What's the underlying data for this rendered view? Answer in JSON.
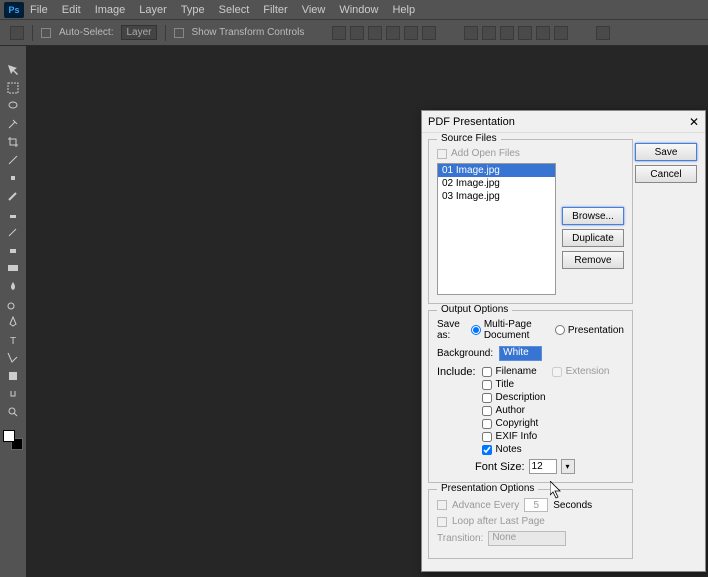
{
  "menu": [
    "File",
    "Edit",
    "Image",
    "Layer",
    "Type",
    "Select",
    "Filter",
    "View",
    "Window",
    "Help"
  ],
  "options": {
    "auto_select": "Auto-Select:",
    "layer": "Layer",
    "show_transform": "Show Transform Controls"
  },
  "dialog": {
    "title": "PDF Presentation",
    "source": {
      "legend": "Source Files",
      "add_open": "Add Open Files",
      "files": [
        "01 Image.jpg",
        "02 Image.jpg",
        "03 Image.jpg"
      ],
      "browse": "Browse...",
      "duplicate": "Duplicate",
      "remove": "Remove"
    },
    "save": "Save",
    "cancel": "Cancel",
    "output": {
      "legend": "Output Options",
      "save_as": "Save as:",
      "multi": "Multi-Page Document",
      "presentation": "Presentation",
      "background": "Background:",
      "bg_value": "White",
      "include": "Include:",
      "filename": "Filename",
      "extension": "Extension",
      "title": "Title",
      "description": "Description",
      "author": "Author",
      "copyright": "Copyright",
      "exif": "EXIF Info",
      "notes": "Notes",
      "font_size": "Font Size:",
      "font_size_val": "12"
    },
    "pres": {
      "legend": "Presentation Options",
      "advance": "Advance Every",
      "adv_val": "5",
      "seconds": "Seconds",
      "loop": "Loop after Last Page",
      "transition": "Transition:",
      "trans_val": "None"
    }
  }
}
